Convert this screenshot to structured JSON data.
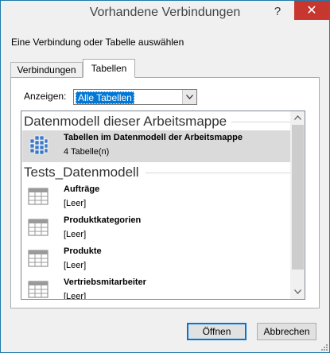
{
  "window": {
    "title": "Vorhandene Verbindungen",
    "help_label": "?",
    "close_label": "✕"
  },
  "prompt": "Eine Verbindung oder Tabelle auswählen",
  "tabs": [
    {
      "label": "Verbindungen",
      "active": false
    },
    {
      "label": "Tabellen",
      "active": true
    }
  ],
  "show_filter": {
    "label": "Anzeigen:",
    "selected": "Alle Tabellen"
  },
  "groups": [
    {
      "header": "Datenmodell dieser Arbeitsmappe",
      "items": [
        {
          "title": "Tabellen im Datenmodell der Arbeitsmappe",
          "subtitle": "4 Tabelle(n)",
          "icon": "data-model-cube-icon",
          "selected": true
        }
      ]
    },
    {
      "header": "Tests_Datenmodell",
      "items": [
        {
          "title": "Aufträge",
          "subtitle": "[Leer]",
          "icon": "table-icon",
          "selected": false
        },
        {
          "title": "Produktkategorien",
          "subtitle": "[Leer]",
          "icon": "table-icon",
          "selected": false
        },
        {
          "title": "Produkte",
          "subtitle": "[Leer]",
          "icon": "table-icon",
          "selected": false
        },
        {
          "title": "Vertriebsmitarbeiter",
          "subtitle": "[Leer]",
          "icon": "table-icon",
          "selected": false
        }
      ]
    }
  ],
  "buttons": {
    "open": "Öffnen",
    "cancel": "Abbrechen"
  },
  "colors": {
    "close_bg": "#c7372f",
    "selection": "#0078d7",
    "item_selected": "#dadada"
  }
}
